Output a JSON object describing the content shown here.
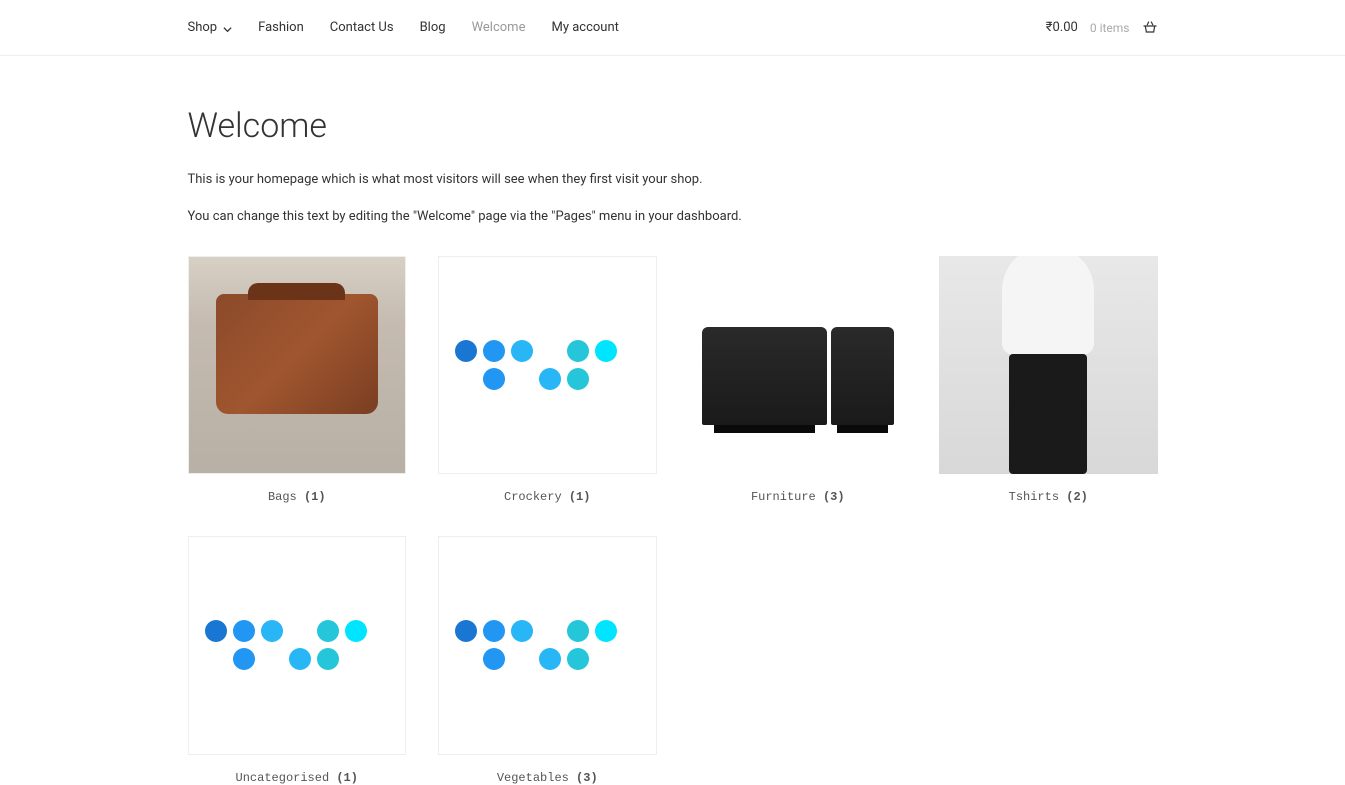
{
  "nav": {
    "items": [
      {
        "label": "Shop",
        "hasDropdown": true
      },
      {
        "label": "Fashion",
        "hasDropdown": false
      },
      {
        "label": "Contact Us",
        "hasDropdown": false
      },
      {
        "label": "Blog",
        "hasDropdown": false
      },
      {
        "label": "Welcome",
        "hasDropdown": false,
        "active": true
      },
      {
        "label": "My account",
        "hasDropdown": false
      }
    ]
  },
  "cart": {
    "price": "₹0.00",
    "items": "0 items"
  },
  "page": {
    "title": "Welcome",
    "intro1": "This is your homepage which is what most visitors will see when they first visit your shop.",
    "intro2": "You can change this text by editing the \"Welcome\" page via the \"Pages\" menu in your dashboard."
  },
  "categories": [
    {
      "name": "Bags",
      "count": "(1)",
      "imageType": "bag"
    },
    {
      "name": "Crockery",
      "count": "(1)",
      "imageType": "dots"
    },
    {
      "name": "Furniture",
      "count": "(3)",
      "imageType": "furniture"
    },
    {
      "name": "Tshirts",
      "count": "(2)",
      "imageType": "tshirt"
    },
    {
      "name": "Uncategorised",
      "count": "(1)",
      "imageType": "dots"
    },
    {
      "name": "Vegetables",
      "count": "(3)",
      "imageType": "dots"
    }
  ],
  "dotColors": {
    "row1": [
      "#1976d2",
      "#2196f3",
      "#29b6f6",
      null,
      "#26c6da",
      "#00e5ff"
    ],
    "row2": [
      null,
      "#2196f3",
      null,
      "#29b6f6",
      "#26c6da",
      null
    ]
  }
}
